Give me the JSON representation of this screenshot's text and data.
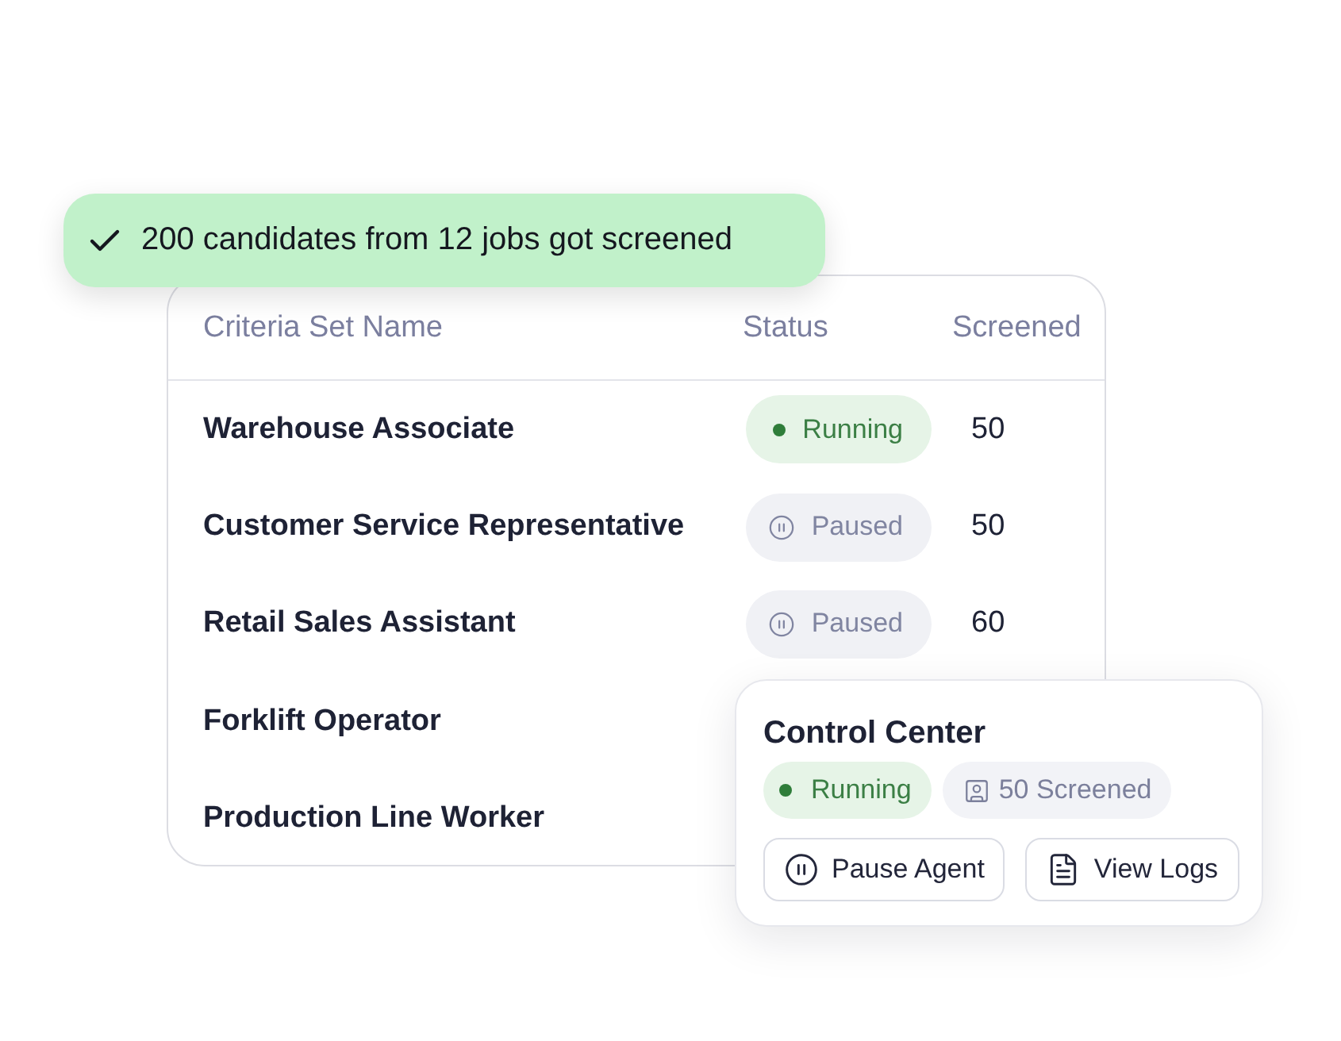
{
  "toast": {
    "text": "200 candidates from 12 jobs got screened"
  },
  "table": {
    "columns": [
      "Criteria Set Name",
      "Status",
      "Screened"
    ],
    "rows": [
      {
        "name": "Warehouse Associate",
        "status": {
          "kind": "running",
          "label": "Running"
        },
        "screened": "50"
      },
      {
        "name": "Customer Service Representative",
        "status": {
          "kind": "paused",
          "label": "Paused"
        },
        "screened": "50"
      },
      {
        "name": "Retail Sales Assistant",
        "status": {
          "kind": "paused",
          "label": "Paused"
        },
        "screened": "60"
      },
      {
        "name": "Forklift Operator"
      },
      {
        "name": "Production Line Worker"
      }
    ]
  },
  "control_center": {
    "title": "Control Center",
    "status": {
      "kind": "running",
      "label": "Running"
    },
    "count": "50 Screened",
    "buttons": [
      {
        "kind": "pause",
        "label": "Pause Agent"
      },
      {
        "kind": "logs",
        "label": "View Logs"
      }
    ]
  }
}
